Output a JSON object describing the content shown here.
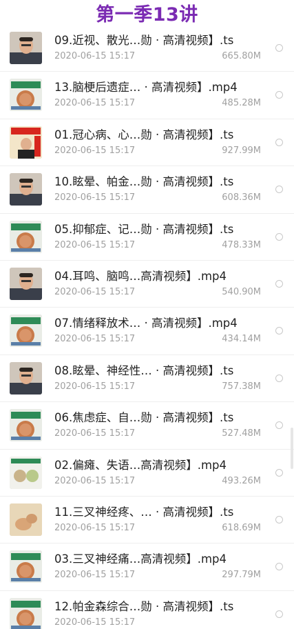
{
  "header": {
    "title": "第一季13讲"
  },
  "files": [
    {
      "name": "09.近视、散光…勋 · 高清视频】.ts",
      "date": "2020-06-15 15:17",
      "size": "665.80M",
      "thumb": "portrait-man"
    },
    {
      "name": "13.脑梗后遗症… · 高清视频】.mp4",
      "date": "2020-06-15 15:17",
      "size": "485.28M",
      "thumb": "slide"
    },
    {
      "name": "01.冠心病、心…勋 · 高清视频】.ts",
      "date": "2020-06-15 15:17",
      "size": "927.99M",
      "thumb": "presenter-red"
    },
    {
      "name": "10.眩晕、帕金…勋 · 高清视频】.ts",
      "date": "2020-06-15 15:17",
      "size": "608.36M",
      "thumb": "portrait-man"
    },
    {
      "name": "05.抑郁症、记…勋 · 高清视频】.ts",
      "date": "2020-06-15 15:17",
      "size": "478.33M",
      "thumb": "slide"
    },
    {
      "name": "04.耳鸣、脑鸣…高清视频】.mp4",
      "date": "2020-06-15 15:17",
      "size": "540.90M",
      "thumb": "portrait-man"
    },
    {
      "name": "07.情绪释放术… · 高清视频】.mp4",
      "date": "2020-06-15 15:17",
      "size": "434.14M",
      "thumb": "slide"
    },
    {
      "name": "08.眩晕、神经性… · 高清视频】.ts",
      "date": "2020-06-15 15:17",
      "size": "757.38M",
      "thumb": "portrait-man"
    },
    {
      "name": "06.焦虑症、自…勋 · 高清视频】.ts",
      "date": "2020-06-15 15:17",
      "size": "527.48M",
      "thumb": "slide"
    },
    {
      "name": "02.偏瘫、失语…高清视频】.mp4",
      "date": "2020-06-15 15:17",
      "size": "493.26M",
      "thumb": "slide-green"
    },
    {
      "name": "11.三叉神经疼、… · 高清视频】.ts",
      "date": "2020-06-15 15:17",
      "size": "618.69M",
      "thumb": "hands"
    },
    {
      "name": "03.三叉神经痛…高清视频】.mp4",
      "date": "2020-06-15 15:17",
      "size": "297.79M",
      "thumb": "slide"
    },
    {
      "name": "12.帕金森综合…勋 · 高清视频】.ts",
      "date": "2020-06-15 15:17",
      "size": "",
      "thumb": "slide"
    }
  ]
}
